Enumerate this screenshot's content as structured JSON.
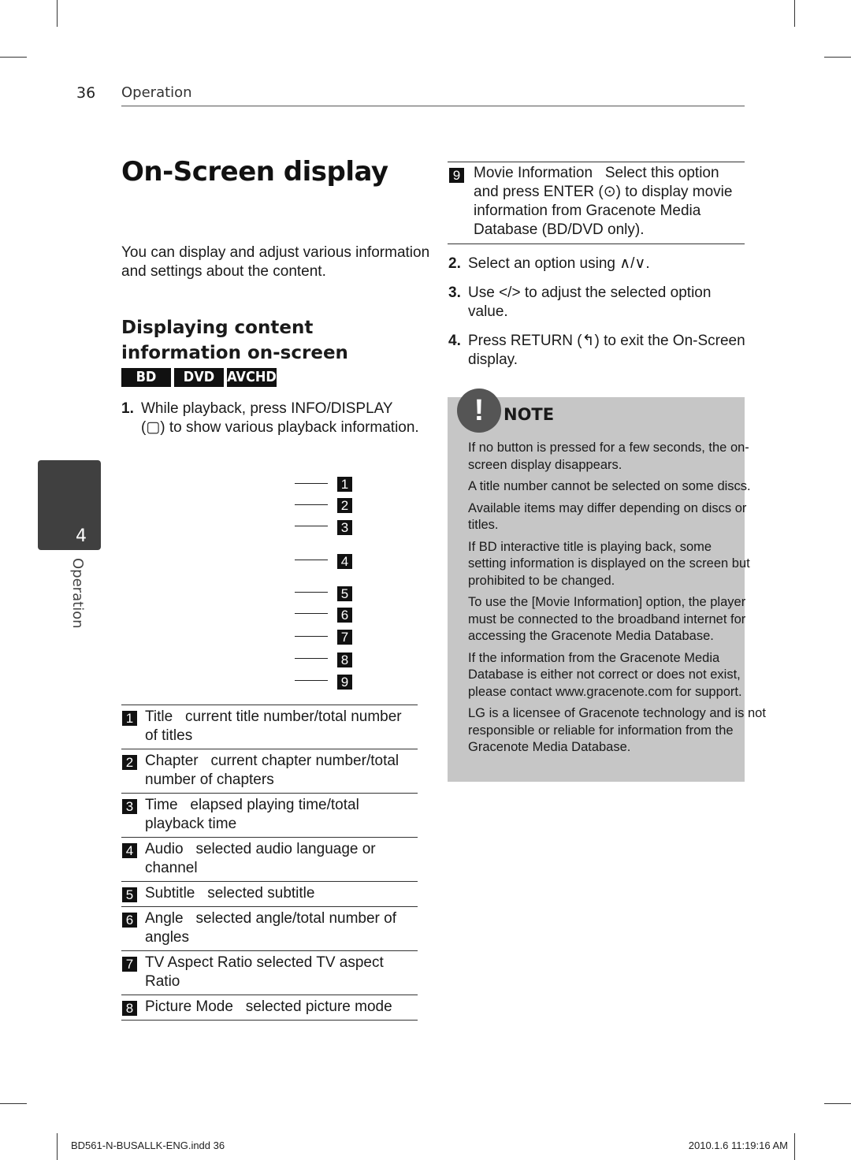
{
  "header": {
    "page_number": "36",
    "section": "Operation"
  },
  "title": "On-Screen display",
  "intro": "You can display and adjust various information and settings about the content.",
  "subtitle": "Displaying content information on-screen",
  "badges": [
    "BD",
    "DVD",
    "AVCHD"
  ],
  "steps": [
    {
      "num": "1.",
      "text": "While playback, press INFO/DISPLAY (▢) to show various playback information."
    },
    {
      "num": "2.",
      "text": "Select an option using ∧/∨."
    },
    {
      "num": "3.",
      "text": "Use </> to adjust the selected option value."
    },
    {
      "num": "4.",
      "text": "Press RETURN (↰) to exit the On-Screen display."
    }
  ],
  "callouts": [
    "1",
    "2",
    "3",
    "4",
    "5",
    "6",
    "7",
    "8",
    "9"
  ],
  "definitions": [
    {
      "num": "1",
      "term": "Title",
      "desc": "current title number/total number of titles"
    },
    {
      "num": "2",
      "term": "Chapter",
      "desc": "current chapter number/total number of chapters"
    },
    {
      "num": "3",
      "term": "Time",
      "desc": "elapsed playing time/total playback time"
    },
    {
      "num": "4",
      "term": "Audio",
      "desc": "selected audio language or channel"
    },
    {
      "num": "5",
      "term": "Subtitle",
      "desc": "selected subtitle"
    },
    {
      "num": "6",
      "term": "Angle",
      "desc": "selected angle/total number of angles"
    },
    {
      "num": "7",
      "term": "TV Aspect Ratio",
      "desc": "selected TV aspect Ratio"
    },
    {
      "num": "8",
      "term": "Picture Mode",
      "desc": "selected picture mode"
    },
    {
      "num": "9",
      "term": "Movie Information",
      "desc": "Select this option and press ENTER (⊙) to display movie information from Gracenote Media Database (BD/DVD only)."
    }
  ],
  "side_tab": {
    "number": "4",
    "label": "Operation"
  },
  "note": {
    "title": "NOTE",
    "items": [
      "If no button is pressed for a few seconds, the on-screen display disappears.",
      "A title number cannot be selected on some discs.",
      "Available items may differ depending on discs or titles.",
      "If BD interactive title is playing back, some setting information is displayed on the screen but prohibited to be changed.",
      "To use the [Movie Information] option, the player must be connected to the broadband internet for accessing the Gracenote Media Database.",
      "If the information from the Gracenote Media Database is either not correct or does not exist, please contact www.gracenote.com for support.",
      "LG is a licensee of Gracenote technology and is not responsible or reliable for information from the Gracenote Media Database."
    ]
  },
  "footer": {
    "file": "BD561-N-BUSALLK-ENG.indd   36",
    "timestamp": "2010.1.6   11:19:16 AM"
  },
  "colors": {
    "note_bg": "#c6c6c6",
    "side_tab": "#404040",
    "badge": "#111111"
  }
}
